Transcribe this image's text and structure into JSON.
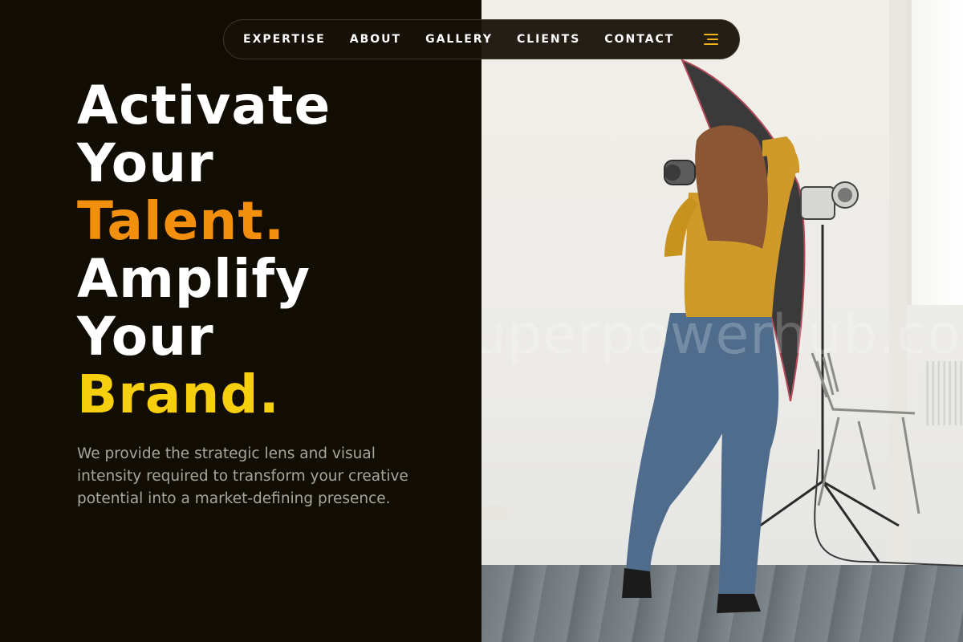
{
  "nav": {
    "items": [
      "EXPERTISE",
      "ABOUT",
      "GALLERY",
      "CLIENTS",
      "CONTACT"
    ],
    "menu_icon": "hamburger-icon",
    "menu_color": "#f2b61b"
  },
  "hero": {
    "lines": [
      "Activate",
      "Your",
      "Talent.",
      "Amplify",
      "Your",
      "Brand."
    ],
    "accent_colors": {
      "talent": "#f2900d",
      "brand": "#f6cf0e"
    },
    "description": "We provide the strategic lens and visual intensity required to transform your creative potential into a market-defining presence."
  },
  "photo": {
    "watermark": "uperpowerhub.co"
  },
  "colors": {
    "background": "#120d02",
    "text": "#ffffff",
    "muted": "#a6a6a0"
  }
}
